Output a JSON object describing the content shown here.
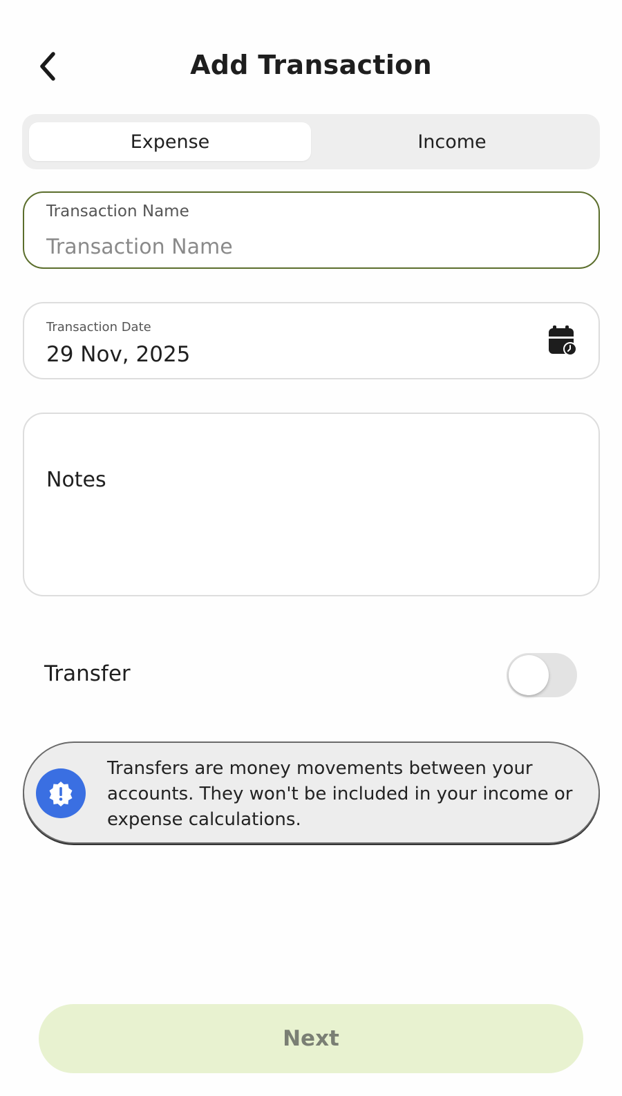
{
  "header": {
    "title": "Add Transaction",
    "back_icon": "chevron-left-icon"
  },
  "type_tabs": {
    "items": [
      {
        "label": "Expense",
        "active": true
      },
      {
        "label": "Income",
        "active": false
      }
    ]
  },
  "transaction_name": {
    "label": "Transaction Name",
    "placeholder": "Transaction Name",
    "value": "",
    "border_color": "#5b6e2c"
  },
  "transaction_date": {
    "label": "Transaction Date",
    "value": "29 Nov, 2025",
    "icon": "calendar-clock-icon"
  },
  "notes": {
    "placeholder": "Notes",
    "value": ""
  },
  "transfer": {
    "label": "Transfer",
    "enabled": false
  },
  "info_banner": {
    "icon": "alert-badge-icon",
    "icon_color": "#3a6fe2",
    "text": "Transfers are money movements between your accounts. They won't be included in your income or expense calculations."
  },
  "next_button": {
    "label": "Next",
    "enabled": false,
    "background": "#e8f2d0"
  }
}
